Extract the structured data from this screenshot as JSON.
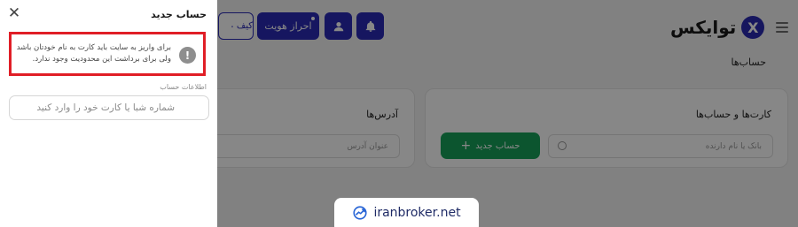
{
  "header": {
    "logo_text": "توایکس",
    "logo_mark": "X",
    "kyc_label": "احراز هویت",
    "card_button_label": "کیف"
  },
  "breadcrumb": "حساب‌ها",
  "accounts_card": {
    "title": "کارت‌ها و حساب‌ها",
    "search_placeholder": "بانک یا نام دارنده",
    "new_account_label": "حساب جدید",
    "new_account_icon": "+"
  },
  "address_card": {
    "title": "آدرس‌ها",
    "search_placeholder": "عنوان آدرس"
  },
  "drawer": {
    "title": "حساب جدید",
    "close_icon": "✕",
    "alert_icon": "!",
    "alert_line1": "برای واریز به سایت باید کارت به نام خودتان باشد",
    "alert_line2": "ولی برای برداشت این محدودیت وجود ندارد.",
    "section_label": "اطلاعات حساب",
    "input_placeholder": "شماره شبا یا کارت خود را وارد کنید"
  },
  "watermark": {
    "text": "iranbroker.net"
  },
  "colors": {
    "brand": "#2a2ab6",
    "success": "#17a15a",
    "alert_border": "#e01e26"
  }
}
